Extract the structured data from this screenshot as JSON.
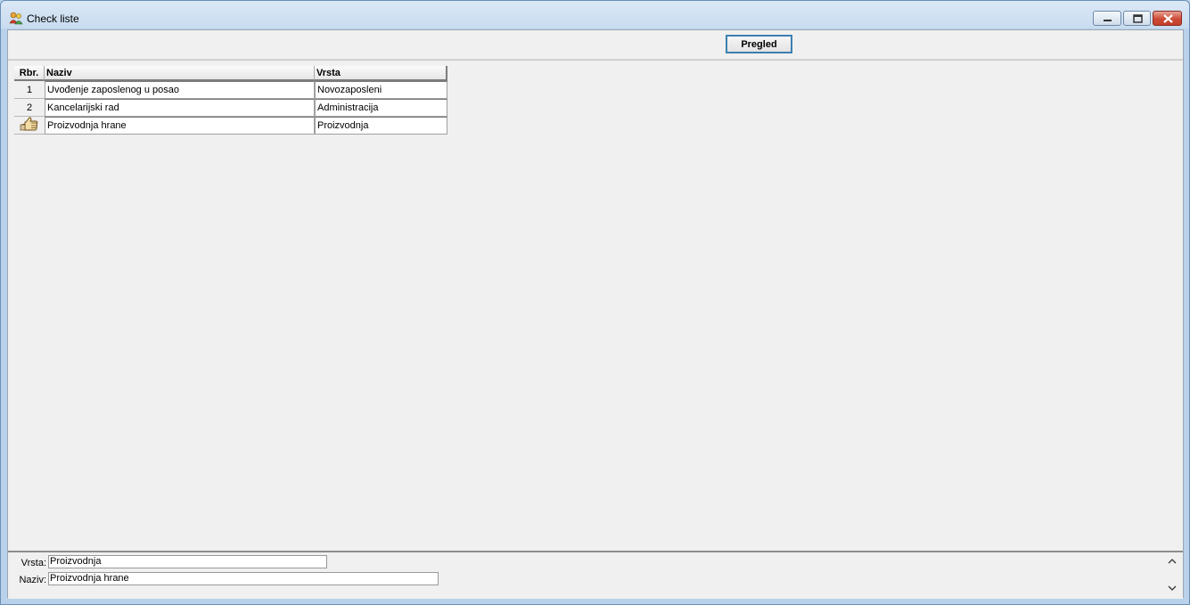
{
  "window": {
    "title": "Check liste"
  },
  "toolbar": {
    "pregled_label": "Pregled"
  },
  "grid": {
    "headers": {
      "rbr": "Rbr.",
      "naziv": "Naziv",
      "vrsta": "Vrsta"
    },
    "rows": [
      {
        "rbr": "1",
        "naziv": "Uvođenje zaposlenog u posao",
        "vrsta": "Novozaposleni"
      },
      {
        "rbr": "2",
        "naziv": "Kancelarijski rad",
        "vrsta": "Administracija"
      },
      {
        "rbr": "",
        "naziv": "Proizvodnja hrane",
        "vrsta": "Proizvodnja",
        "current": true
      }
    ]
  },
  "details": {
    "vrsta_label": "Vrsta:",
    "vrsta_value": "Proizvodnja",
    "naziv_label": "Naziv:",
    "naziv_value": "Proizvodnja hrane"
  },
  "icons": {
    "app": "users-icon",
    "current_row": "pointing-hand-icon",
    "scroll_up": "chevron-up-icon",
    "scroll_down": "chevron-down-icon"
  },
  "colors": {
    "accent": "#3c7fb1",
    "close_button": "#cd4b36"
  }
}
